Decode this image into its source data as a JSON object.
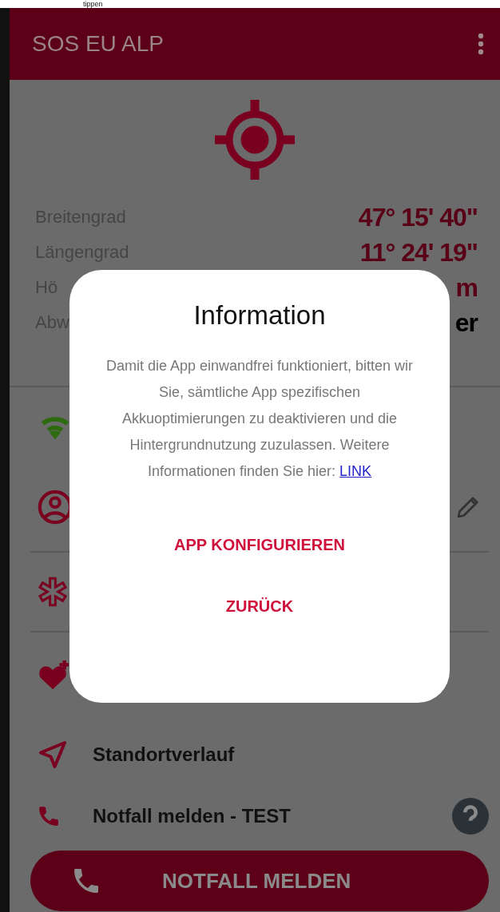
{
  "top_caption": "tippen",
  "app_bar": {
    "title": "SOS EU ALP"
  },
  "coordinates": [
    {
      "label": "Breitengrad",
      "value": "47° 15' 40\"",
      "kind": "coordinate"
    },
    {
      "label": "Längengrad",
      "value": "11° 24' 19\"",
      "kind": "coordinate"
    },
    {
      "label": "Hö",
      "value": "m",
      "kind": "coordinate"
    },
    {
      "label": "Abw",
      "value": "er",
      "kind": "text"
    }
  ],
  "menu_items": [
    {
      "kind": "wifi"
    },
    {
      "kind": "profile",
      "editable": true,
      "divider_after": true
    },
    {
      "kind": "medical",
      "divider_after": true
    },
    {
      "kind": "heart"
    },
    {
      "kind": "location",
      "label": "Standortverlauf"
    },
    {
      "kind": "phone",
      "label": "Notfall melden - TEST",
      "help": true
    }
  ],
  "emergency_button": {
    "label": "NOTFALL MELDEN"
  },
  "dialog": {
    "title": "Information",
    "message": "Damit die App einwandfrei funktioniert, bitten wir Sie, sämtliche App spezifischen Akkuoptimierungen zu deaktivieren und die Hintergrundnutzung zuzulassen. Weitere Informationen finden Sie hier:",
    "link": "LINK",
    "buttons": [
      "APP KONFIGURIEREN",
      "ZURÜCK"
    ]
  }
}
